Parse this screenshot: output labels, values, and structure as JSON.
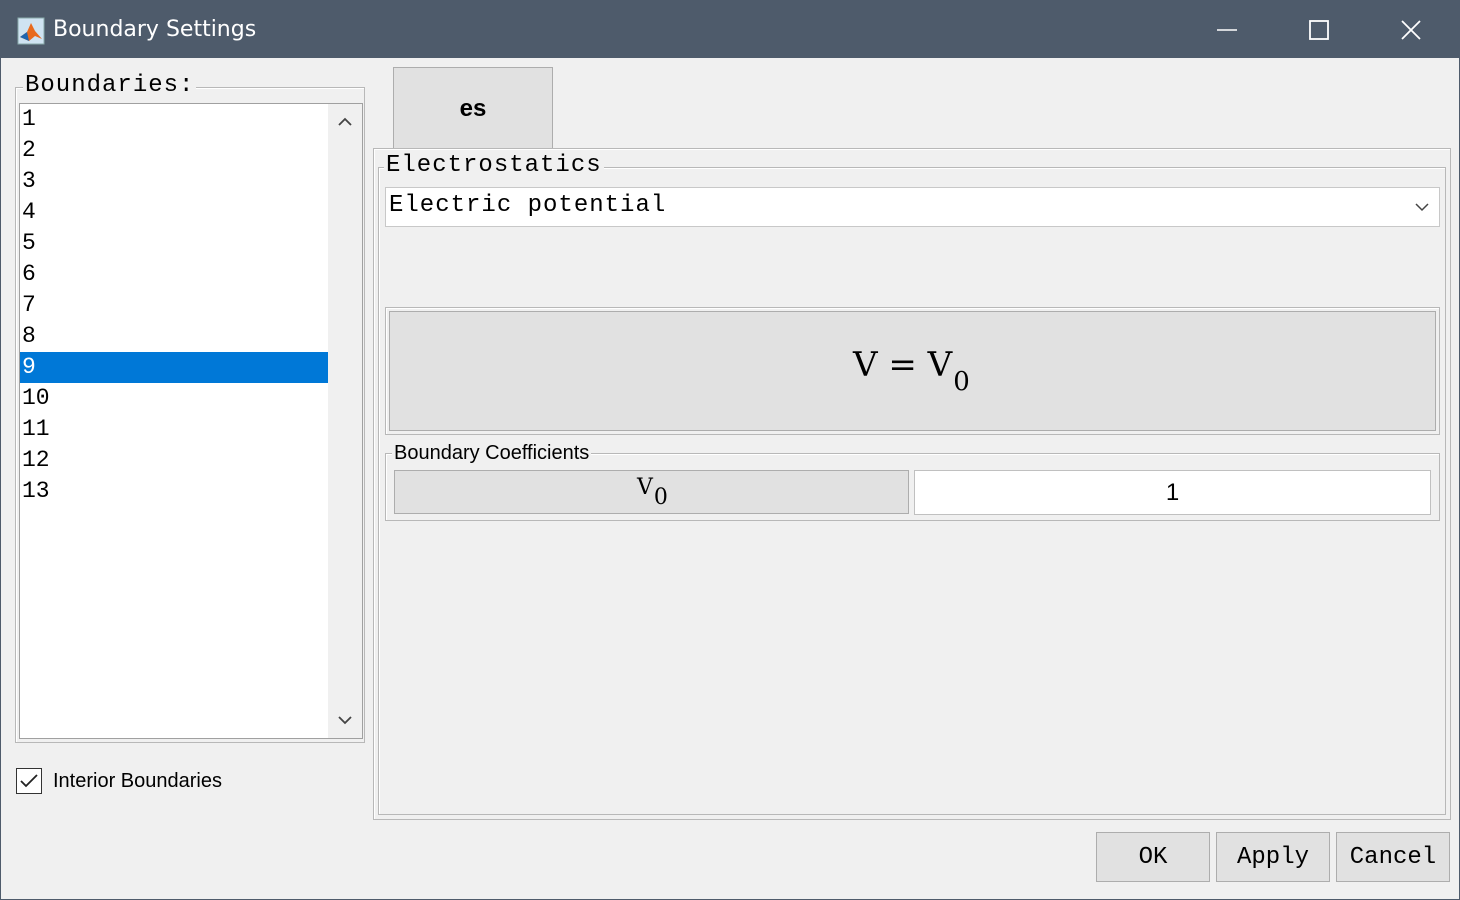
{
  "window": {
    "title": "Boundary Settings"
  },
  "boundaries": {
    "legend": "Boundaries:",
    "items": [
      "1",
      "2",
      "3",
      "4",
      "5",
      "6",
      "7",
      "8",
      "9",
      "10",
      "11",
      "12",
      "13"
    ],
    "selected": "9"
  },
  "interior": {
    "label": "Interior Boundaries",
    "checked": true
  },
  "tab": {
    "label": "es"
  },
  "electrostatics": {
    "legend": "Electrostatics",
    "dropdown_value": "Electric potential",
    "equation_lhs": "V = V",
    "equation_sub": "0"
  },
  "coefficients": {
    "legend": "Boundary Coefficients",
    "name": "V",
    "name_sub": "0",
    "value": "1"
  },
  "buttons": {
    "ok": "OK",
    "apply": "Apply",
    "cancel": "Cancel"
  },
  "colors": {
    "titlebar": "#4e5b6b",
    "selection": "#0078d7"
  }
}
